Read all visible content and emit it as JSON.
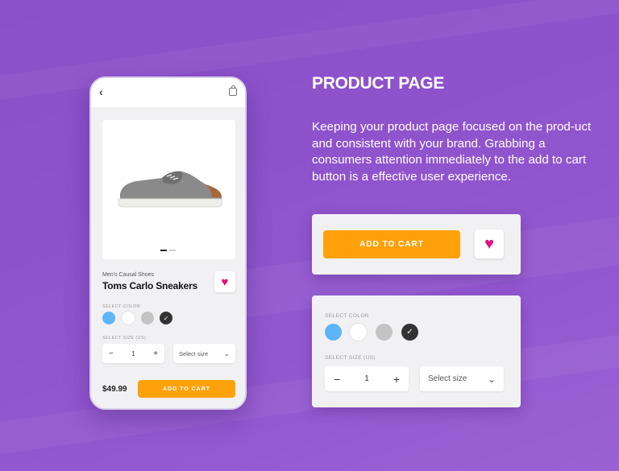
{
  "colors": {
    "accent_orange": "#ffa10a",
    "heart_pink": "#e0127a",
    "swatch_blue": "#5db4f7",
    "swatch_white": "#ffffff",
    "swatch_gray": "#c4c4c4",
    "swatch_black": "#333333"
  },
  "phone": {
    "back_icon": "chevron-left-icon",
    "bag_icon": "shopping-bag-icon",
    "category": "Men's Causal Shoes",
    "product_name": "Toms Carlo Sneakers",
    "select_color_label": "SELECT COLOR",
    "select_size_label": "SELECT SIZE (US)",
    "quantity": "1",
    "minus": "−",
    "plus": "+",
    "size_select": "Select size",
    "price": "$49.99",
    "add_to_cart": "ADD TO CART"
  },
  "right": {
    "title": "PRODUCT PAGE",
    "description": "Keeping your product page focused on the prod-uct and consistent with your brand. Grabbing a consumers attention immediately to the add to cart button is a effective user experience.",
    "add_to_cart": "ADD TO CART",
    "select_color_label": "SELECT COLOR",
    "select_size_label": "SELECT SIZE (US)",
    "quantity": "1",
    "minus": "−",
    "plus": "+",
    "size_select": "Select size"
  }
}
